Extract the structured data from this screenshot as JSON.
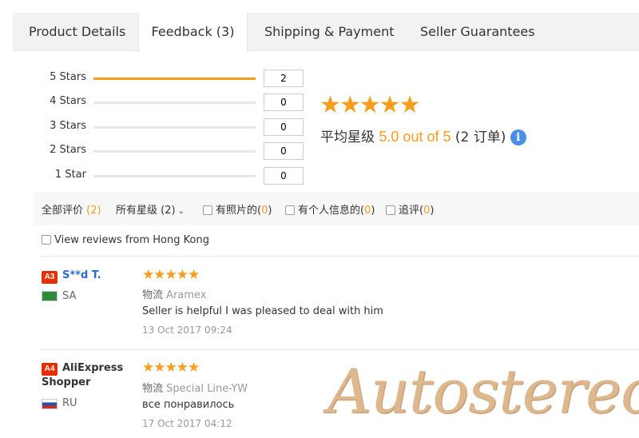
{
  "tabs": [
    {
      "label": "Product Details"
    },
    {
      "label": "Feedback (3)"
    },
    {
      "label": "Shipping & Payment"
    },
    {
      "label": "Seller Guarantees"
    }
  ],
  "rating_breakdown": [
    {
      "label": "5 Stars",
      "count": "2",
      "fill": 1.0
    },
    {
      "label": "4 Stars",
      "count": "0",
      "fill": 0
    },
    {
      "label": "3 Stars",
      "count": "0",
      "fill": 0
    },
    {
      "label": "2 Stars",
      "count": "0",
      "fill": 0
    },
    {
      "label": "1 Star",
      "count": "0",
      "fill": 0
    }
  ],
  "summary": {
    "stars": "★★★★★",
    "prefix": "平均星级",
    "score": "5.0 out of 5",
    "orders": "(2 订单)",
    "info_icon": "info-icon"
  },
  "filters": {
    "all_label": "全部评价",
    "all_count": "(2)",
    "star_select": "所有星级 (2)",
    "photo_label": "有照片的",
    "photo_open": "(",
    "photo_count": "0",
    "photo_close": ")",
    "info_label": "有个人信息的",
    "info_open": "(",
    "info_count": "0",
    "info_close": ")",
    "followup_label": "追评",
    "followup_open": "(",
    "followup_count": "0",
    "followup_close": ")"
  },
  "hk_filter": {
    "label": "View reviews from Hong Kong"
  },
  "reviews": [
    {
      "badge": "A3",
      "name": "S**d T.",
      "country": "SA",
      "stars": "★★★★★",
      "logistics_label": "物流",
      "logistics": "Aramex",
      "text": "Seller is helpful I was pleased to deal with him",
      "date": "13 Oct 2017 09:24"
    },
    {
      "badge": "A4",
      "name_line1": "AliExpress",
      "name_line2": "Shopper",
      "country": "RU",
      "stars": "★★★★★",
      "logistics_label": "物流",
      "logistics": "Special Line-YW",
      "text": "все понравилось",
      "date": "17 Oct 2017 04:12"
    }
  ],
  "watermark": "Autostereo",
  "colors": {
    "accent": "#f89c1c",
    "link": "#2f6bcc",
    "badge": "#e62e04",
    "info": "#4a8fe7"
  }
}
